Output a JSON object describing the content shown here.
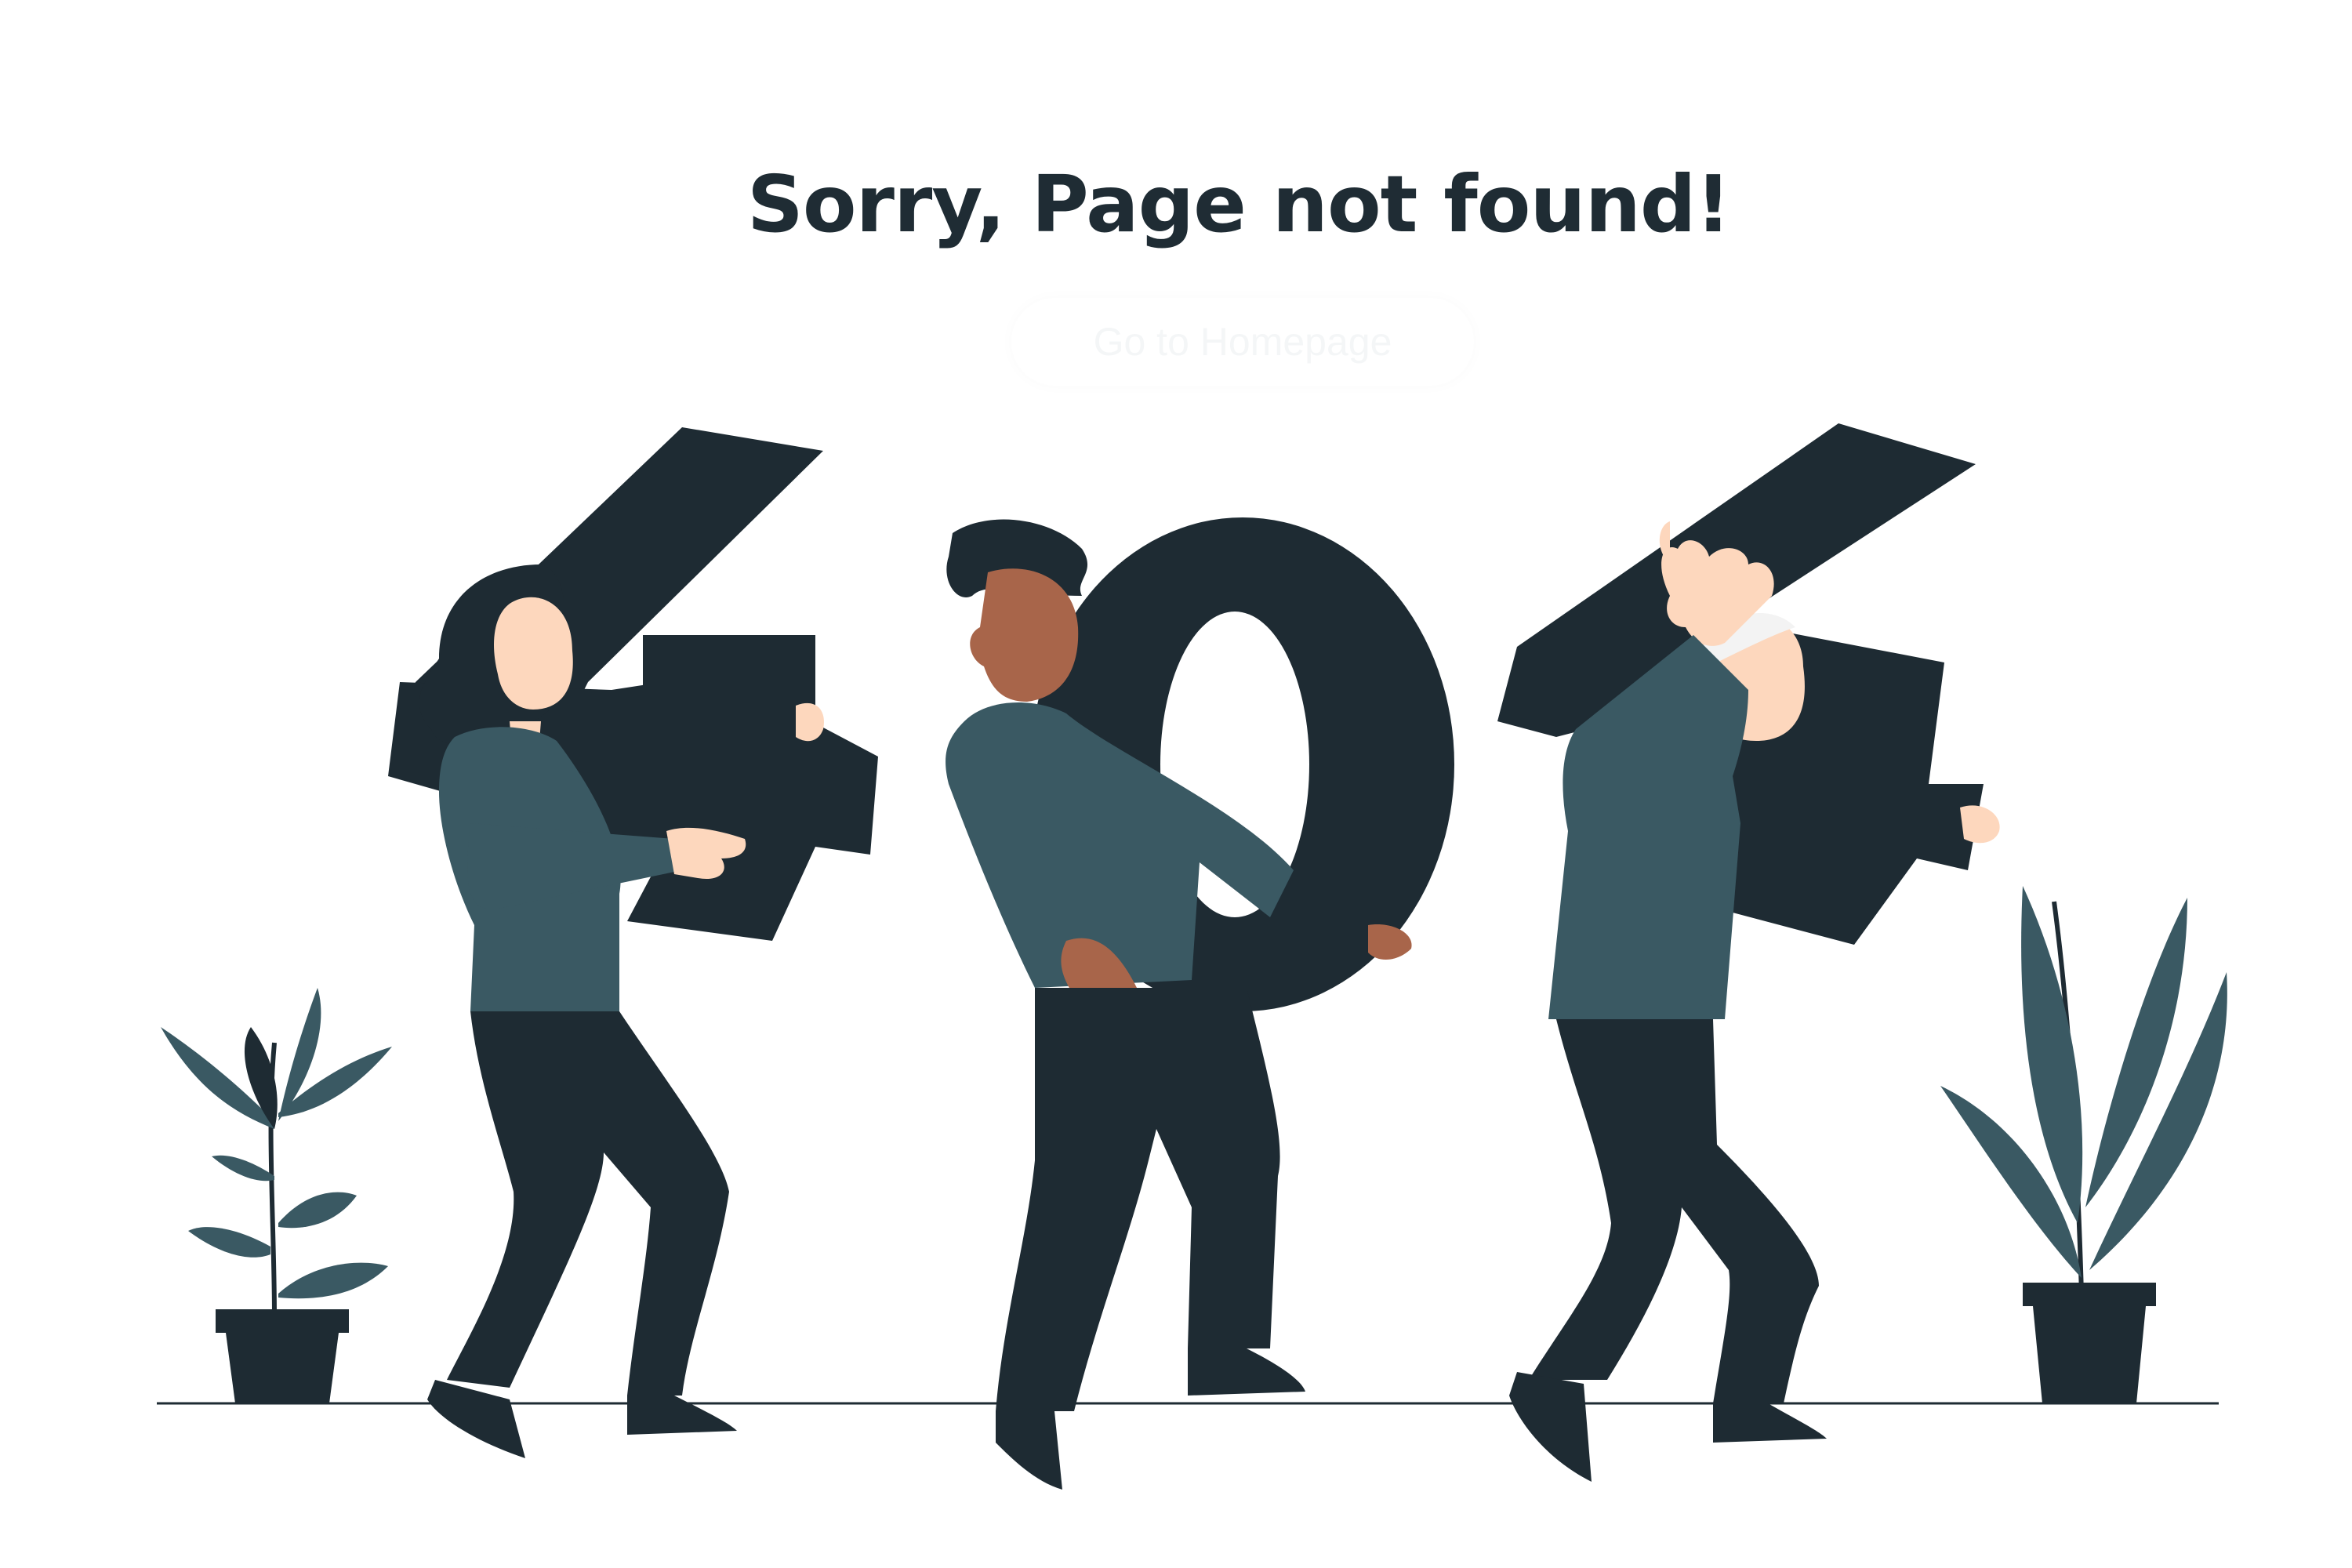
{
  "header": {
    "title": "Sorry, Page not found!"
  },
  "actions": {
    "home_label": "Go to Homepage"
  },
  "theme": {
    "text": "#1f2c34",
    "dark": "#1e2b33",
    "shirt": "#3a5963",
    "skin_light": "#fdd7bd",
    "skin_dark": "#a8654a",
    "background": "#ffffff"
  },
  "illustration": {
    "characters": [
      "4",
      "0",
      "4"
    ]
  }
}
